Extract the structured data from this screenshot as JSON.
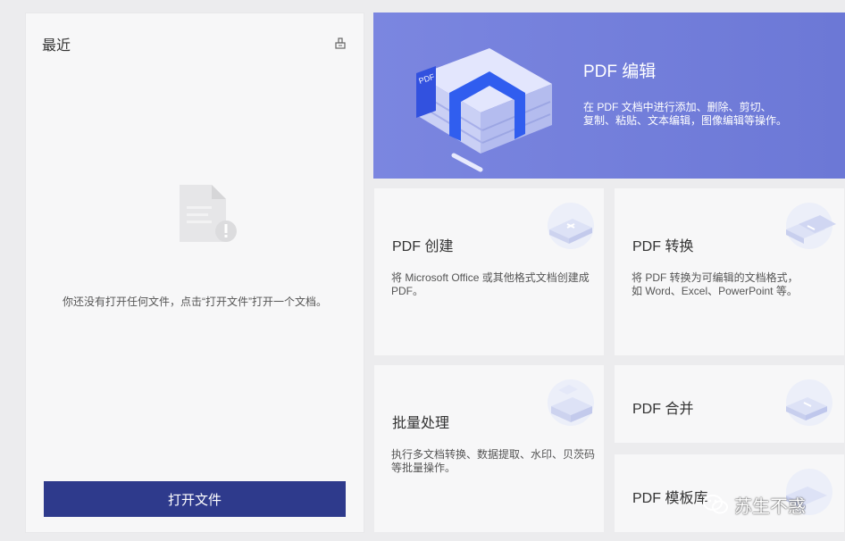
{
  "recent": {
    "title": "最近",
    "empty_message": "你还没有打开任何文件，点击“打开文件”打开一个文档。",
    "open_button": "打开文件"
  },
  "hero": {
    "title": "PDF 编辑",
    "desc_line1": "在 PDF 文档中进行添加、删除、剪切、",
    "desc_line2": "复制、粘贴、文本编辑，图像编辑等操作。"
  },
  "cards": {
    "create": {
      "title": "PDF 创建",
      "desc_line1": "将 Microsoft Office 或其他格式文档创建成",
      "desc_line2": "PDF。"
    },
    "convert": {
      "title": "PDF 转换",
      "desc_line1": "将 PDF 转换为可编辑的文档格式，",
      "desc_line2": "如 Word、Excel、PowerPoint 等。"
    },
    "batch": {
      "title": "批量处理",
      "desc_line1": "执行多文档转换、数据提取、水印、贝茨码",
      "desc_line2": "等批量操作。"
    },
    "merge": {
      "title": "PDF 合并"
    },
    "template": {
      "title": "PDF 模板库"
    }
  },
  "watermark": {
    "text": "苏生不惑"
  },
  "colors": {
    "primary_button": "#2e3a8c",
    "hero_bg": "#7b86e0"
  }
}
